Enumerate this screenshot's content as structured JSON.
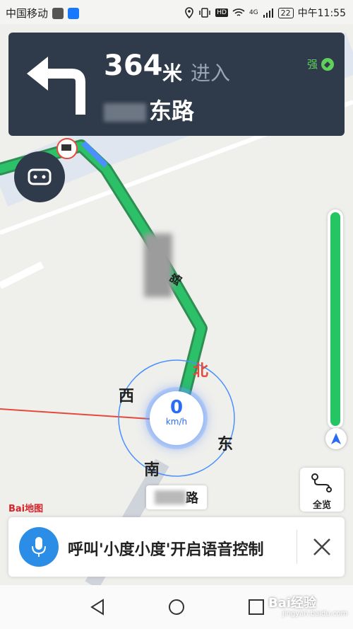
{
  "status_bar": {
    "carrier": "中国移动",
    "battery": "22",
    "time": "中午11:55",
    "network": "4G"
  },
  "guidance": {
    "distance": "364",
    "unit": "米",
    "action": "进入",
    "road_suffix": "东路",
    "gps_strength": "强",
    "turn_icon": "turn-left-icon"
  },
  "map": {
    "road_label": "路",
    "compass": {
      "north": "北",
      "south": "南",
      "east": "东",
      "west": "西"
    },
    "speed": "0",
    "speed_unit": "km/h",
    "bottom_road_suffix": "路",
    "traffic_color": "#25c564",
    "route_color": "#2cc068"
  },
  "overview_button": {
    "label": "全览",
    "icon": "route-overview-icon"
  },
  "logo": "Bai地图",
  "voice_bar": {
    "text": "呼叫'小度小度'开启语音控制",
    "mic_icon": "microphone-icon",
    "close_icon": "close-icon"
  },
  "watermark": {
    "title": "Bai经验",
    "url": "jingyan.baidu.com"
  }
}
